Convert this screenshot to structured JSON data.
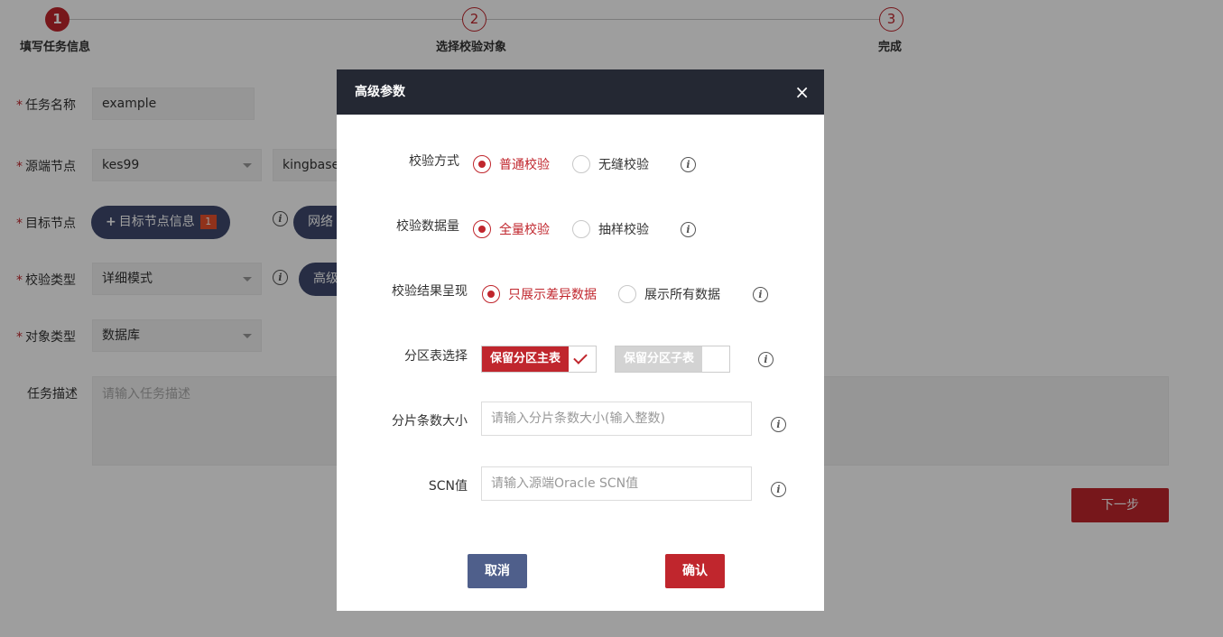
{
  "steps": [
    {
      "num": "1",
      "label": "填写任务信息"
    },
    {
      "num": "2",
      "label": "选择校验对象"
    },
    {
      "num": "3",
      "label": "完成"
    }
  ],
  "form": {
    "task_name_label": "任务名称",
    "task_name_value": "example",
    "source_node_label": "源端节点",
    "source_node_value": "kes99",
    "source_db_value": "kingbase",
    "target_node_label": "目标节点",
    "target_node_button": "目标节点信息",
    "target_node_badge": "1",
    "network_button": "网络",
    "check_type_label": "校验类型",
    "check_type_value": "详细模式",
    "advanced_button": "高级",
    "object_type_label": "对象类型",
    "object_type_value": "数据库",
    "task_desc_label": "任务描述",
    "task_desc_placeholder": "请输入任务描述",
    "required_mark": "*",
    "next_button": "下一步",
    "plus_glyph": "+"
  },
  "modal": {
    "title": "高级参数",
    "close_glyph": "×",
    "info_glyph": "i",
    "check_method": {
      "label": "校验方式",
      "options": [
        "普通校验",
        "无缝校验"
      ],
      "selected": "普通校验"
    },
    "check_volume": {
      "label": "校验数据量",
      "options": [
        "全量校验",
        "抽样校验"
      ],
      "selected": "全量校验"
    },
    "result_display": {
      "label": "校验结果呈现",
      "options": [
        "只展示差异数据",
        "展示所有数据"
      ],
      "selected": "只展示差异数据"
    },
    "partition": {
      "label": "分区表选择",
      "options": [
        {
          "text": "保留分区主表",
          "checked": true
        },
        {
          "text": "保留分区子表",
          "checked": false
        }
      ]
    },
    "shard_size": {
      "label": "分片条数大小",
      "placeholder": "请输入分片条数大小(输入整数)"
    },
    "scn": {
      "label": "SCN值",
      "placeholder": "请输入源端Oracle SCN值"
    },
    "cancel_button": "取消",
    "confirm_button": "确认"
  },
  "colors": {
    "accent": "#c0262d",
    "header_bg": "#242833",
    "pill_bg": "#3f4a6e",
    "cancel_bg": "#4f5f8b"
  }
}
